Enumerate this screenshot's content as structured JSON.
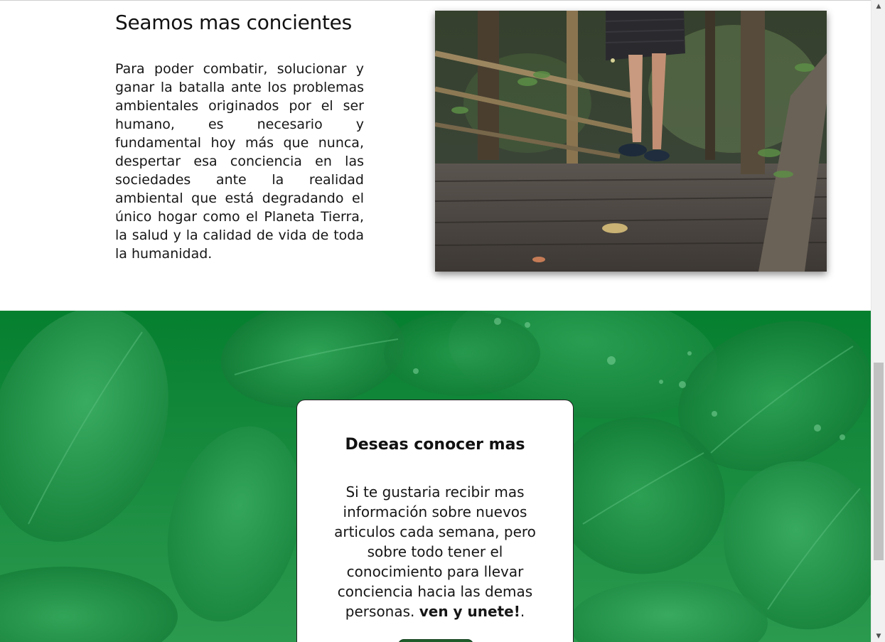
{
  "intro": {
    "title": "Seamos mas concientes",
    "paragraph": "Para poder combatir, solucionar y ganar la batalla ante los problemas ambientales originados por el ser humano, es necesario y fundamental hoy más que nunca, despertar esa conciencia en las sociedades ante la realidad ambiental que está degradando el único hogar como el Planeta Tierra, la salud y la calidad de vida de toda la humanidad."
  },
  "card": {
    "title": "Deseas conocer mas",
    "text": "Si te gustaria recibir mas información sobre nuevos articulos cada semana, pero sobre todo tener el conocimiento para llevar conciencia hacia las demas personas. ",
    "text_emphasis": "ven y unete!",
    "text_end": "."
  },
  "colors": {
    "green_top": "#05802f",
    "green_bottom": "#2b9a4f",
    "button": "#1f5f2c"
  },
  "scrollbar": {
    "up_icon": "triangle-up-icon",
    "down_icon": "triangle-down-icon"
  }
}
